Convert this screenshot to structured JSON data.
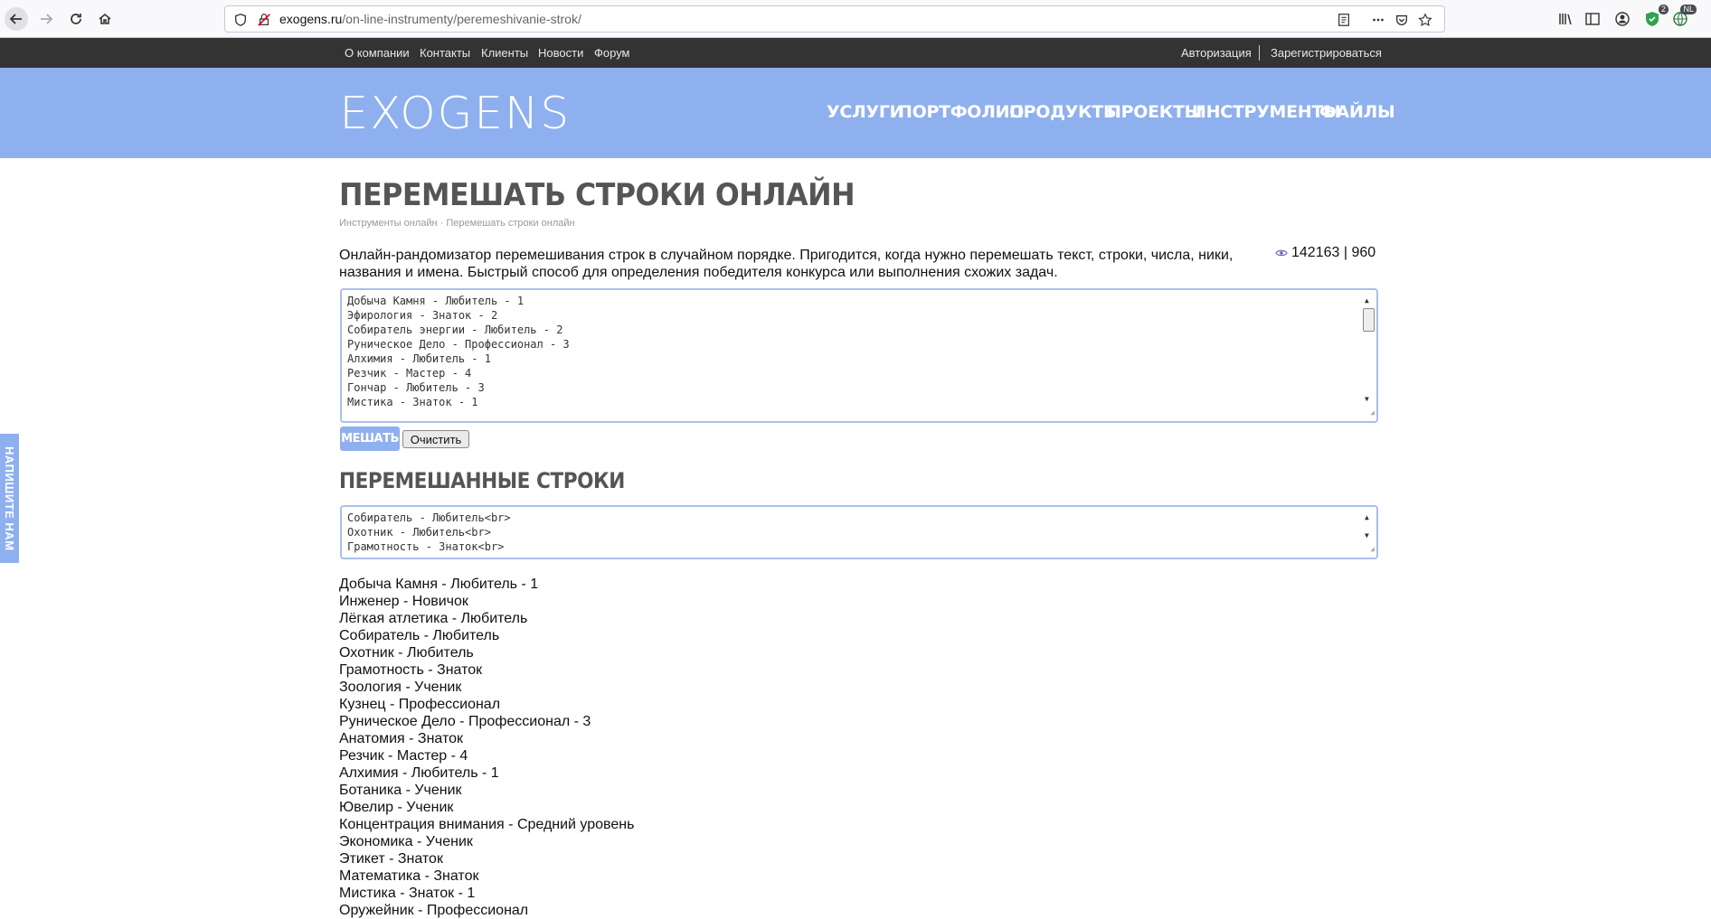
{
  "browser": {
    "url_domain": "exogens.ru",
    "url_path": "/on-line-instrumenty/peremeshivanie-strok/",
    "ext_badge_count": "2",
    "lang_badge": "NL"
  },
  "topbar": {
    "links": [
      "О компании",
      "Контакты",
      "Клиенты",
      "Новости",
      "Форум"
    ],
    "login": "Авторизация",
    "register": "Зарегистрироваться"
  },
  "header": {
    "logo": "EXOGENS",
    "nav": [
      "УСЛУГИ",
      "ПОРТФОЛИО",
      "ПРОДУКТЫ",
      "ПРОЕКТЫ",
      "ИНСТРУМЕНТЫ",
      "ФАЙЛЫ"
    ]
  },
  "page": {
    "title": "ПЕРЕМЕШАТЬ СТРОКИ ОНЛАЙН",
    "breadcrumb_root": "Инструменты онлайн",
    "breadcrumb_sep": "·",
    "breadcrumb_current": "Перемешать строки онлайн",
    "description": "Онлайн-рандомизатор перемешивания строк в случайном порядке. Пригодится, когда нужно перемешать текст, строки, числа, ники, названия и имена. Быстрый способ для определения победителя конкурса или выполнения схожих задач.",
    "views": "142163 | 960"
  },
  "input_box": {
    "lines": [
      "Добыча Камня - Любитель - 1",
      "Эфирология - Знаток - 2",
      "Собиратель энергии - Любитель - 2",
      "Руническое Дело - Профессионал - 3",
      "Алхимия - Любитель - 1",
      "Резчик - Мастер - 4",
      "Гончар - Любитель - 3",
      "Мистика - Знаток - 1"
    ]
  },
  "buttons": {
    "mix": "МЕШАТЬ",
    "clear": "Очистить"
  },
  "result_section": {
    "title": "ПЕРЕМЕШАННЫЕ СТРОКИ"
  },
  "output_box": {
    "lines": [
      "Собиратель - Любитель<br>",
      "Охотник - Любитель<br>",
      "Грамотность - Знаток<br>"
    ]
  },
  "result_list": [
    "Добыча Камня - Любитель - 1",
    "Инженер - Новичок",
    "Лёгкая атлетика - Любитель",
    "Собиратель - Любитель",
    "Охотник - Любитель",
    "Грамотность - Знаток",
    "Зоология - Ученик",
    "Кузнец - Профессионал",
    "Руническое Дело - Профессионал - 3",
    "Анатомия - Знаток",
    "Резчик - Мастер - 4",
    "Алхимия - Любитель - 1",
    "Ботаника - Ученик",
    "Ювелир - Ученик",
    "Концентрация внимания - Средний уровень",
    "Экономика - Ученик",
    "Этикет - Знаток",
    "Математика - Знаток",
    "Мистика - Знаток - 1",
    "Оружейник - Профессионал"
  ],
  "feedback_tab": "НАПИШИТЕ НАМ"
}
